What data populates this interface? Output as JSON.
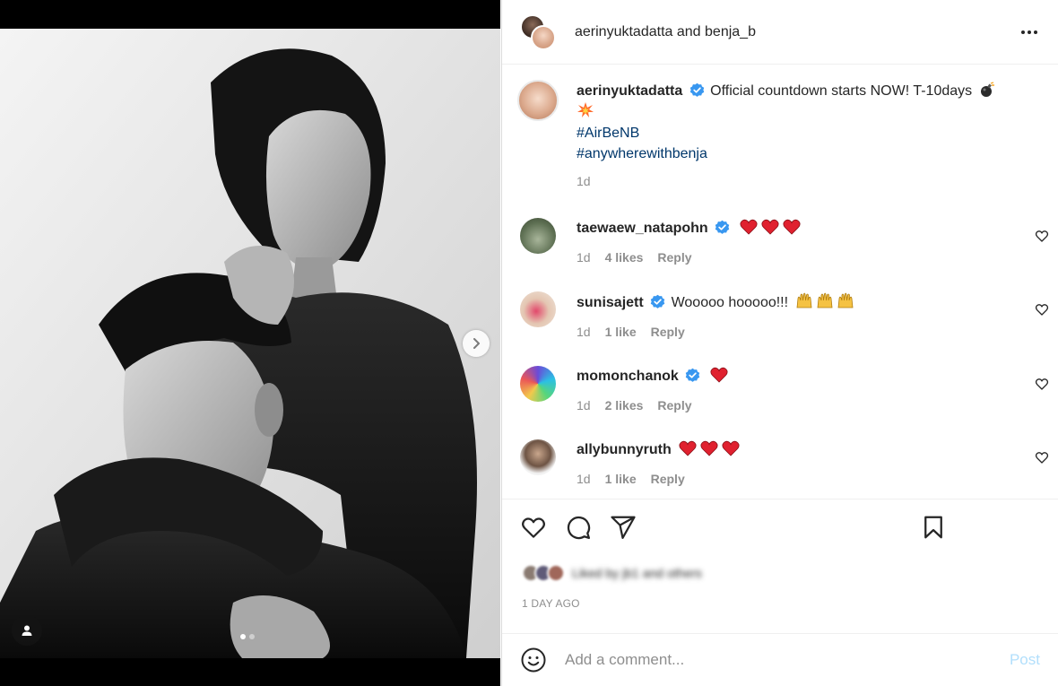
{
  "header": {
    "owner": "aerinyuktadatta",
    "joiner": "and",
    "collaborator": "benja_b"
  },
  "caption": {
    "username": "aerinyuktadatta",
    "text": "Official countdown starts NOW! T-10days",
    "hashtags": [
      "#AirBeNB",
      "#anywherewithbenja"
    ],
    "time": "1d"
  },
  "comments": [
    {
      "username": "taewaew_natapohn",
      "verified": true,
      "emoji_count": 3,
      "emoji": "heart",
      "text": "",
      "time": "1d",
      "likes": "4 likes",
      "reply": "Reply"
    },
    {
      "username": "sunisajett",
      "verified": true,
      "text": "Wooooo hooooo!!!",
      "emoji_count": 3,
      "emoji": "raising-hands",
      "time": "1d",
      "likes": "1 like",
      "reply": "Reply"
    },
    {
      "username": "momonchanok",
      "verified": true,
      "emoji_count": 1,
      "emoji": "heart",
      "text": "",
      "time": "1d",
      "likes": "2 likes",
      "reply": "Reply"
    },
    {
      "username": "allybunnyruth",
      "verified": false,
      "emoji_count": 3,
      "emoji": "heart",
      "text": "",
      "time": "1d",
      "likes": "1 like",
      "reply": "Reply"
    }
  ],
  "actions": {
    "icons": [
      "heart-icon",
      "comment-icon",
      "share-icon",
      "bookmark-icon"
    ],
    "liked_by_text": "Liked by jb1 and others",
    "time_ago": "1 DAY AGO"
  },
  "add_comment": {
    "placeholder": "Add a comment...",
    "post_label": "Post"
  },
  "colors": {
    "link": "#00376b",
    "muted": "#8e8e8e",
    "verified": "#3897f0",
    "post_disabled": "#b2dffc"
  },
  "carousel": {
    "current": 1,
    "total": 2
  }
}
